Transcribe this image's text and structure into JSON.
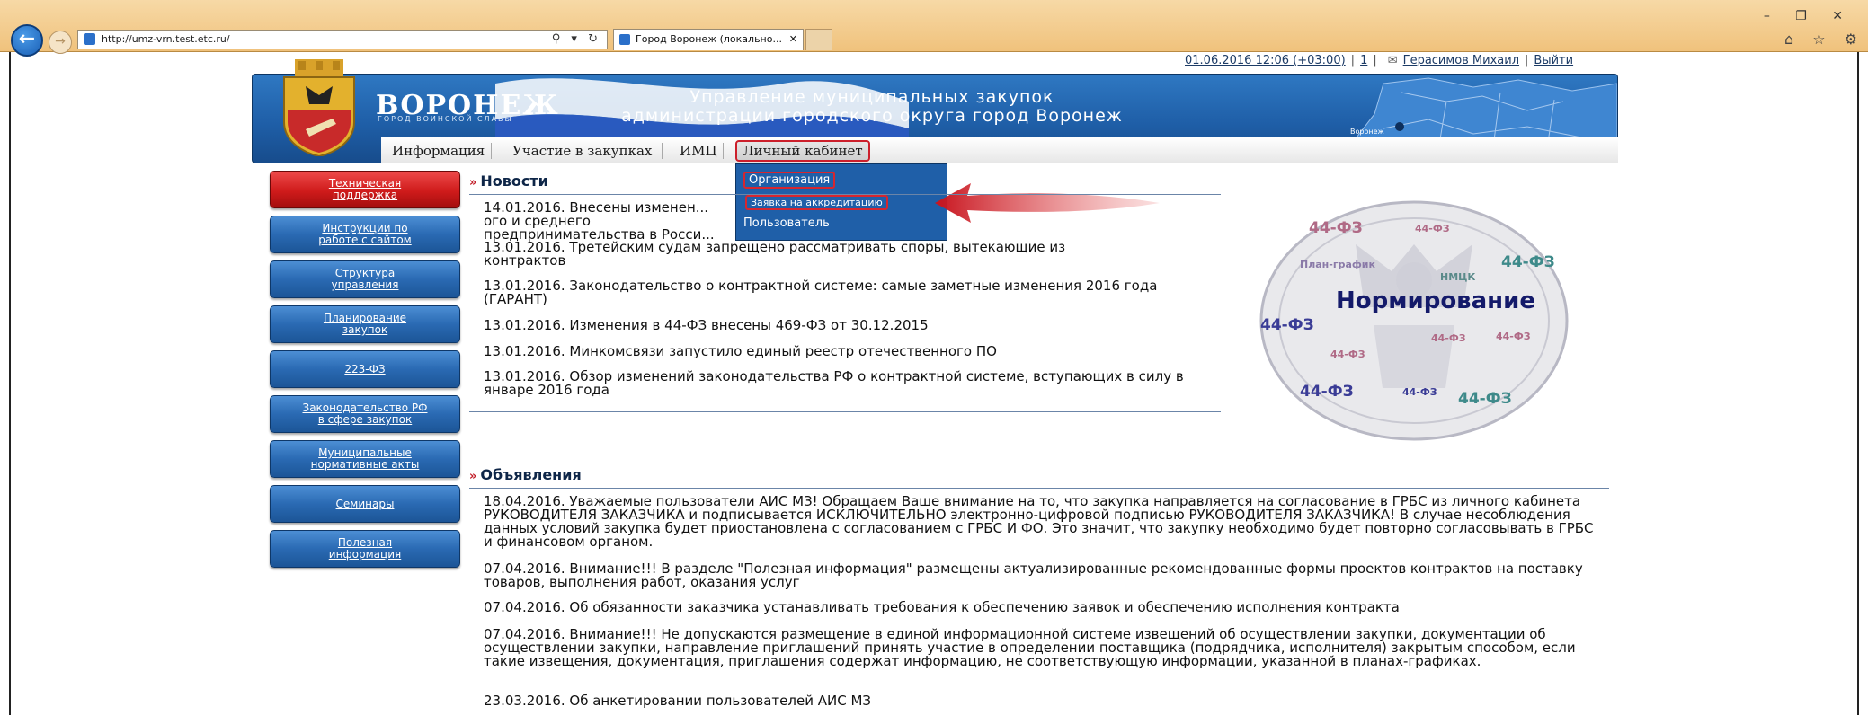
{
  "browser": {
    "url": "http://umz-vrn.test.etc.ru/",
    "tab_title": "Город Воронеж (локально...",
    "address_tools": "⚲ ▾ ↻",
    "tab_close": "✕",
    "window_controls": "–  ❐  ✕",
    "toolbar_icons": "⌂ ☆ ⚙"
  },
  "userbar": {
    "datetime": "01.06.2016 12:06 (+03:00)",
    "count": "1",
    "user": "Герасимов Михаил",
    "logout": "Выйти"
  },
  "banner": {
    "city": "ВОРОНЕЖ",
    "city_subtitle": "ГОРОД ВОИНСКОЙ СЛАВЫ",
    "org_line1": "Управление муниципальных закупок",
    "org_line2": "администрации городского округа город Воронеж",
    "map_label": "Воронеж"
  },
  "menu": {
    "items": [
      "Информация",
      "Участие в закупках",
      "ИМЦ",
      "Личный кабинет"
    ]
  },
  "dropdown": {
    "items": [
      "Организация",
      "Заявка на аккредитацию",
      "Пользователь"
    ]
  },
  "sidebar": {
    "items": [
      {
        "line1": "Техническая",
        "line2": "поддержка"
      },
      {
        "line1": "Инструкции по",
        "line2": "работе с сайтом"
      },
      {
        "line1": "Структура",
        "line2": "управления"
      },
      {
        "line1": "Планирование",
        "line2": "закупок"
      },
      {
        "line1": "223-ФЗ",
        "line2": ""
      },
      {
        "line1": "Законодательство РФ",
        "line2": "в сфере закупок"
      },
      {
        "line1": "Муниципальные",
        "line2": "нормативные акты"
      },
      {
        "line1": "Семинары",
        "line2": ""
      },
      {
        "line1": "Полезная",
        "line2": "информация"
      }
    ]
  },
  "news": {
    "title": "Новости",
    "items": [
      "14.01.2016. Внесены изменен... ого и среднего предпринимательства в Росси...",
      "13.01.2016. Третейским судам запрещено рассматривать споры, вытекающие из контрактов",
      "13.01.2016. Законодательство о контрактной системе: самые заметные изменения 2016 года (ГАРАНТ)",
      "13.01.2016. Изменения в 44-ФЗ внесены 469-ФЗ от 30.12.2015",
      "13.01.2016. Минкомсвязи запустило единый реестр отечественного ПО",
      "13.01.2016. Обзор изменений законодательства РФ о контрактной системе, вступающих в силу в январе 2016 года"
    ]
  },
  "announcements": {
    "title": "Объявления",
    "items": [
      "18.04.2016. Уважаемые пользователи АИС МЗ! Обращаем Ваше внимание на то, что закупка направляется на согласование в ГРБС из личного кабинета РУКОВОДИТЕЛЯ ЗАКАЗЧИКА и подписывается ИСКЛЮЧИТЕЛЬНО электронно-цифровой подписью РУКОВОДИТЕЛЯ ЗАКАЗЧИКА! В случае несоблюдения данных условий закупка будет приостановлена с согласованием с ГРБС И ФО. Это значит, что закупку необходимо будет повторно согласовывать в ГРБС и финансовом органом.",
      "07.04.2016. Внимание!!! В разделе \"Полезная информация\" размещены актуализированные рекомендованные формы проектов контрактов на поставку товаров, выполнения работ, оказания услуг",
      "07.04.2016. Об обязанности заказчика устанавливать требования к обеспечению заявок и обеспечению исполнения контракта",
      "07.04.2016. Внимание!!! Не допускаются размещение в единой информационной системе извещений об осуществлении закупки, документации об осуществлении закупки, направление приглашений принять участие в определении поставщика (подрядчика, исполнителя) закрытым способом, если такие извещения, документация, приглашения содержат информацию, не соответствующую информации, указанной в планах-графиках.",
      "23.03.2016. Об анкетировании пользователей АИС МЗ"
    ]
  },
  "promo": {
    "title": "Нормирование",
    "labels": [
      "44-ФЗ",
      "44-ФЗ",
      "44-ФЗ",
      "44-ФЗ",
      "44-ФЗ",
      "44-ФЗ",
      "44-ФЗ",
      "План-график",
      "НМЦК",
      "44-ФЗ",
      "44-ФЗ",
      "44-ФЗ"
    ]
  },
  "colors": {
    "header_blue": "#1f5fa8",
    "accent_red": "#cc1f2b",
    "promo_title": "#141a6a"
  }
}
